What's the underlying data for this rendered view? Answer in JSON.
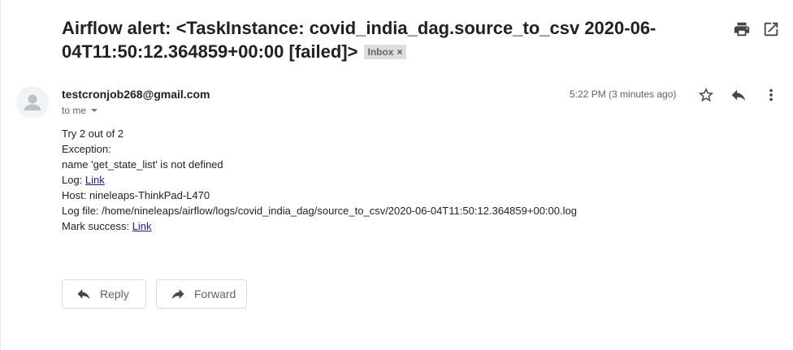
{
  "email": {
    "subject": "Airflow alert: <TaskInstance: covid_india_dag.source_to_csv 2020-06-04T11:50:12.364859+00:00 [failed]>",
    "label": "Inbox",
    "label_close": "×",
    "sender": "testcronjob268@gmail.com",
    "recipient": "to me",
    "time": "5:22 PM (3 minutes ago)",
    "body": {
      "try": "Try 2 out of 2",
      "exception": "Exception:",
      "error": "name 'get_state_list' is not defined",
      "log_label": "Log: ",
      "log_link": "Link",
      "host": "Host: nineleaps-ThinkPad-L470",
      "log_file": "Log file: /home/nineleaps/airflow/logs/covid_india_dag/source_to_csv/2020-06-04T11:50:12.364859+00:00.log",
      "mark_label": "Mark success: ",
      "mark_link": "Link"
    }
  },
  "actions": {
    "reply": "Reply",
    "forward": "Forward"
  },
  "icons": {
    "print": "print-icon",
    "open_new_window": "open-in-new-icon",
    "star": "star-icon",
    "reply": "reply-icon",
    "more": "more-vert-icon",
    "avatar": "person-icon",
    "forward": "forward-icon"
  },
  "colors": {
    "link": "#2a14b8",
    "chip_bg": "#dddddd",
    "icon": "#444746"
  }
}
